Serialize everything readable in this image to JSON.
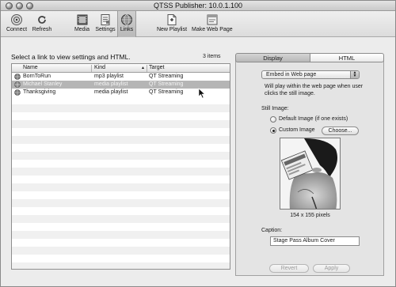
{
  "window": {
    "title": "QTSS Publisher: 10.0.1.100"
  },
  "toolbar": {
    "connect": "Connect",
    "refresh": "Refresh",
    "media": "Media",
    "settings": "Settings",
    "links": "Links",
    "new_playlist": "New Playlist",
    "make_web_page": "Make Web Page"
  },
  "list": {
    "header": "Select a link to view settings and HTML.",
    "count": "3 items",
    "columns": {
      "name": "Name",
      "kind": "Kind",
      "target": "Target"
    },
    "sort_column": "Kind",
    "rows": [
      {
        "name": "BornToRun",
        "kind": "mp3 playlist",
        "target": "QT Streaming",
        "selected": false
      },
      {
        "name": "Michael Stanley",
        "kind": "media playlist",
        "target": "QT Streaming",
        "selected": true
      },
      {
        "name": "Thanksgiving",
        "kind": "media playlist",
        "target": "QT Streaming",
        "selected": false
      }
    ]
  },
  "panel": {
    "tabs": {
      "display": "Display",
      "html": "HTML"
    },
    "active_tab": "HTML",
    "embed_select": "Embed in Web page",
    "description": "Will play within the web page when user clicks the still image.",
    "still_label": "Still Image:",
    "default_image": "Default Image (if one exists)",
    "custom_image": "Custom Image",
    "selected_image_option": "Custom Image",
    "choose": "Choose...",
    "pixels": "154 x 155 pixels",
    "caption_label": "Caption:",
    "caption_value": "Stage Pass Album Cover",
    "revert": "Revert",
    "apply": "Apply"
  },
  "colors": {
    "selection": "#b5b5b5",
    "window_bg": "#ececec"
  }
}
